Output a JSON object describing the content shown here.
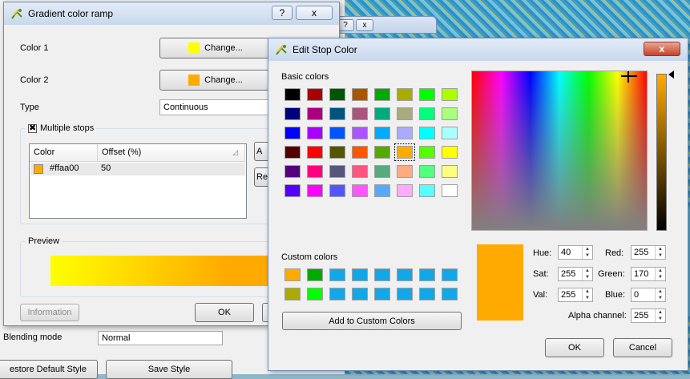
{
  "background": {
    "row_label_1": "Blending mode",
    "row_value_1": "Normal",
    "restore_button": "estore Default Style",
    "save_style_button": "Save Style",
    "titlebar_help": "?",
    "titlebar_close": "x"
  },
  "gradient_dialog": {
    "title": "Gradient color ramp",
    "help_button": "?",
    "close_button": "x",
    "color1_label": "Color 1",
    "color1_button": "Change...",
    "color1_swatch": "#ffff00",
    "color2_label": "Color 2",
    "color2_button": "Change...",
    "color2_swatch": "#ffaa00",
    "type_label": "Type",
    "type_value": "Continuous",
    "multiple_stops_label": "Multiple stops",
    "multiple_stops_checked": true,
    "stops_table": {
      "headers": [
        "Color",
        "Offset (%)"
      ],
      "rows": [
        {
          "color": "#ffaa00",
          "label": "#ffaa00",
          "offset": "50"
        }
      ]
    },
    "add_button_partial": "A",
    "remove_button_partial": "Re",
    "preview_label": "Preview",
    "information_button": "Information",
    "ok_button": "OK"
  },
  "edit_stop_dialog": {
    "title": "Edit Stop Color",
    "close_button": "x",
    "basic_colors_label": "Basic colors",
    "basic_colors": [
      "#000000",
      "#aa0000",
      "#005500",
      "#aa5500",
      "#00aa00",
      "#aaaa00",
      "#00ff00",
      "#aaff00",
      "#00007f",
      "#aa007f",
      "#00557f",
      "#aa557f",
      "#00aa7f",
      "#aaaa7f",
      "#00ff7f",
      "#aaff7f",
      "#0000ff",
      "#aa00ff",
      "#0055ff",
      "#aa55ff",
      "#00aaff",
      "#aaaaff",
      "#00ffff",
      "#aaffff",
      "#550000",
      "#ff0000",
      "#555500",
      "#ff5500",
      "#55aa00",
      "#ffaa00",
      "#55ff00",
      "#ffff00",
      "#55007f",
      "#ff007f",
      "#55557f",
      "#ff557f",
      "#55aa7f",
      "#ffaa7f",
      "#55ff7f",
      "#ffff7f",
      "#5500ff",
      "#ff00ff",
      "#5555ff",
      "#ff55ff",
      "#55aaff",
      "#ffaaff",
      "#55ffff",
      "#ffffff"
    ],
    "selected_basic_index": 29,
    "custom_colors_label": "Custom colors",
    "custom_colors": [
      "#ffaa00",
      "#00aa00",
      "#12a8e8",
      "#12a8e8",
      "#12a8e8",
      "#12a8e8",
      "#12a8e8",
      "#12a8e8",
      "#aaaa00",
      "#00ff00",
      "#12a8e8",
      "#12a8e8",
      "#12a8e8",
      "#12a8e8",
      "#12a8e8",
      "#12a8e8"
    ],
    "add_custom_button": "Add to Custom Colors",
    "current_color": "#ffaa00",
    "hue_label": "Hue:",
    "hue": "40",
    "sat_label": "Sat:",
    "sat": "255",
    "val_label": "Val:",
    "val": "255",
    "red_label": "Red:",
    "red": "255",
    "green_label": "Green:",
    "green": "170",
    "blue_label": "Blue:",
    "blue": "0",
    "alpha_label": "Alpha channel:",
    "alpha": "255",
    "ok_button": "OK",
    "cancel_button": "Cancel"
  }
}
